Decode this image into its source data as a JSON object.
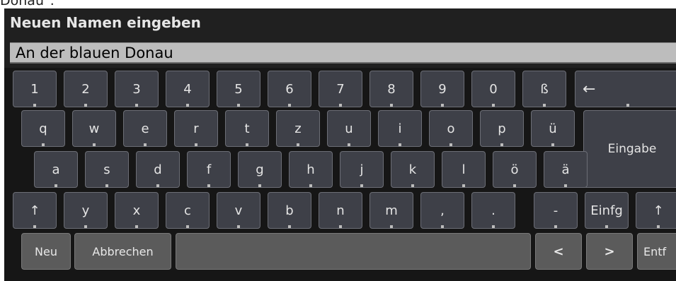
{
  "caption": "Donau\".",
  "dialog": {
    "title": "Neuen Namen eingeben",
    "input_value": "An der blauen Donau"
  },
  "keyboard": {
    "row_digits": [
      "1",
      "2",
      "3",
      "4",
      "5",
      "6",
      "7",
      "8",
      "9",
      "0",
      "ß",
      "←"
    ],
    "row_top": [
      "q",
      "w",
      "e",
      "r",
      "t",
      "z",
      "u",
      "i",
      "o",
      "p",
      "ü"
    ],
    "enter": "Eingabe",
    "row_middle": [
      "a",
      "s",
      "d",
      "f",
      "g",
      "h",
      "j",
      "k",
      "l",
      "ö",
      "ä"
    ],
    "row_bottom": [
      "↑",
      "y",
      "x",
      "c",
      "v",
      "b",
      "n",
      "m",
      ",",
      ".",
      "-",
      "Einfg",
      "↑"
    ],
    "row_function": {
      "new": "Neu",
      "cancel": "Abbrechen",
      "space": "",
      "left": "<",
      "right": ">",
      "delete": "Entf"
    }
  }
}
